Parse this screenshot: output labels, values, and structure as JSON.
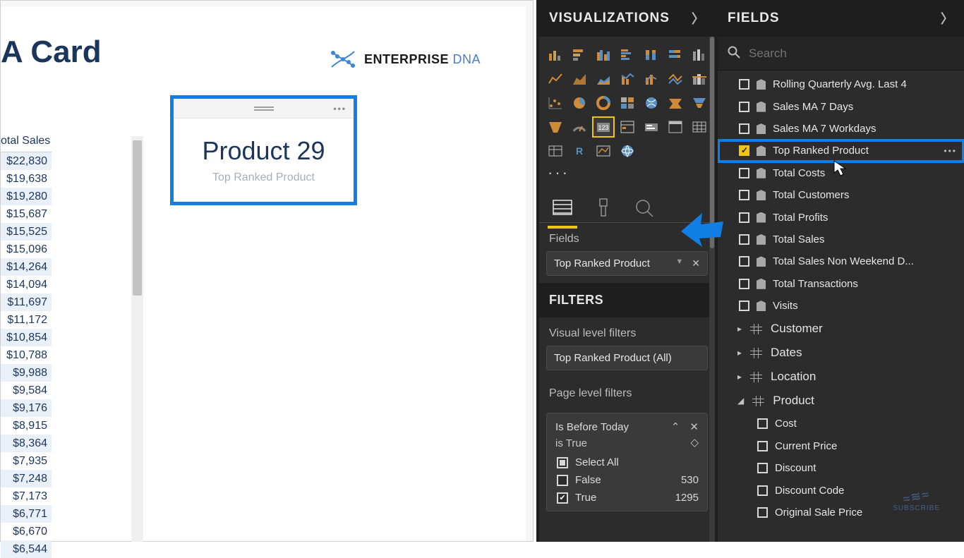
{
  "page_title": "A Card",
  "logo": {
    "brand": "ENTERPRISE",
    "suffix": "DNA"
  },
  "sales_table": {
    "header": "otal Sales",
    "rows": [
      "$22,830",
      "$19,638",
      "$19,280",
      "$15,687",
      "$15,525",
      "$15,096",
      "$14,264",
      "$14,094",
      "$11,697",
      "$11,172",
      "$10,854",
      "$10,788",
      "$9,988",
      "$9,584",
      "$9,176",
      "$8,915",
      "$8,364",
      "$7,935",
      "$7,248",
      "$7,173",
      "$6,771",
      "$6,670",
      "$6,544"
    ]
  },
  "card": {
    "value": "Product 29",
    "label": "Top Ranked Product"
  },
  "vis_pane": {
    "title": "VISUALIZATIONS",
    "fields_label": "Fields",
    "field_well": "Top Ranked Product",
    "filters_title": "FILTERS",
    "visual_filters_label": "Visual level filters",
    "visual_filter_item": "Top Ranked Product (All)",
    "page_filters_label": "Page level filters",
    "page_filter": {
      "name": "Is Before Today",
      "summary": "is True",
      "opts": [
        {
          "label": "Select All",
          "state": "tri",
          "count": ""
        },
        {
          "label": "False",
          "state": "",
          "count": "530"
        },
        {
          "label": "True",
          "state": "checked",
          "count": "1295"
        }
      ]
    }
  },
  "fields_pane": {
    "title": "FIELDS",
    "search_placeholder": "Search",
    "measures": [
      {
        "label": "Rolling Quarterly Avg. Last 4",
        "checked": false
      },
      {
        "label": "Sales MA 7 Days",
        "checked": false
      },
      {
        "label": "Sales MA 7 Workdays",
        "checked": false
      },
      {
        "label": "Top Ranked Product",
        "checked": true,
        "highlight": true
      },
      {
        "label": "Total Costs",
        "checked": false
      },
      {
        "label": "Total Customers",
        "checked": false
      },
      {
        "label": "Total Profits",
        "checked": false
      },
      {
        "label": "Total Sales",
        "checked": false
      },
      {
        "label": "Total Sales Non Weekend D...",
        "checked": false
      },
      {
        "label": "Total Transactions",
        "checked": false
      },
      {
        "label": "Visits",
        "checked": false
      }
    ],
    "tables": [
      {
        "label": "Customer",
        "expanded": false
      },
      {
        "label": "Dates",
        "expanded": false
      },
      {
        "label": "Location",
        "expanded": false
      },
      {
        "label": "Product",
        "expanded": true,
        "cols": [
          "Cost",
          "Current Price",
          "Discount",
          "Discount Code",
          "Original Sale Price"
        ]
      }
    ]
  },
  "subscribe": "SUBSCRIBE"
}
